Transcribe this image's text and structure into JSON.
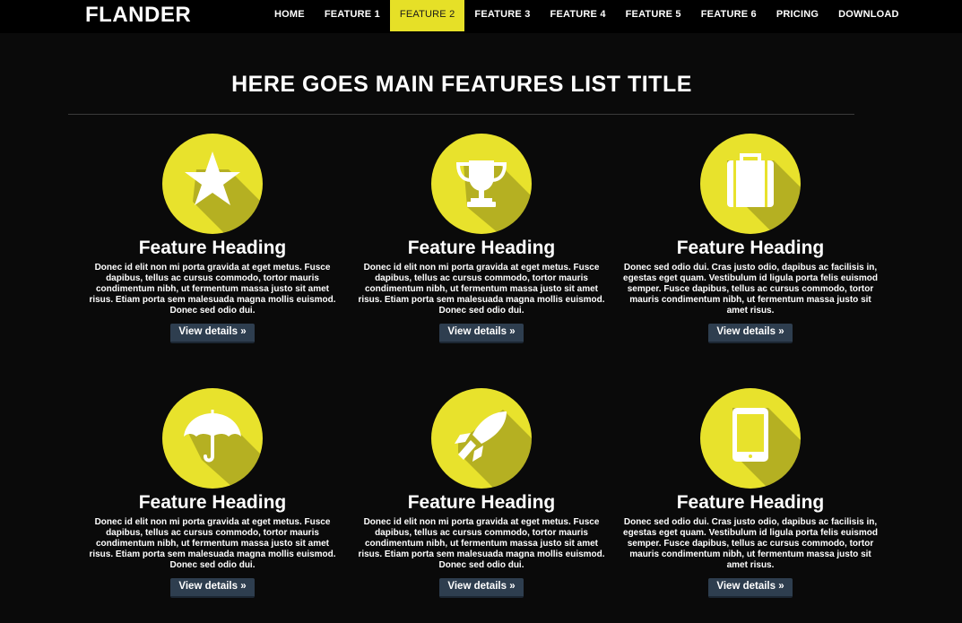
{
  "brand": "FLANDER",
  "nav": {
    "items": [
      {
        "label": "HOME",
        "active": false
      },
      {
        "label": "FEATURE 1",
        "active": false
      },
      {
        "label": "FEATURE 2",
        "active": true
      },
      {
        "label": "FEATURE 3",
        "active": false
      },
      {
        "label": "FEATURE 4",
        "active": false
      },
      {
        "label": "FEATURE 5",
        "active": false
      },
      {
        "label": "FEATURE 6",
        "active": false
      },
      {
        "label": "PRICING",
        "active": false
      },
      {
        "label": "DOWNLOAD",
        "active": false
      }
    ]
  },
  "colors": {
    "accent": "#e6e027",
    "background": "#0a0a0a",
    "button": "#2e3e4f"
  },
  "main": {
    "title": "HERE GOES MAIN FEATURES LIST TITLE"
  },
  "features": [
    {
      "icon": "star-icon",
      "heading": "Feature Heading",
      "text": "Donec id elit non mi porta gravida at eget metus. Fusce dapibus, tellus ac cursus commodo, tortor mauris condimentum nibh, ut fermentum massa justo sit amet risus. Etiam porta sem malesuada magna mollis euismod. Donec sed odio dui.",
      "button": "View details »"
    },
    {
      "icon": "trophy-icon",
      "heading": "Feature Heading",
      "text": "Donec id elit non mi porta gravida at eget metus. Fusce dapibus, tellus ac cursus commodo, tortor mauris condimentum nibh, ut fermentum massa justo sit amet risus. Etiam porta sem malesuada magna mollis euismod. Donec sed odio dui.",
      "button": "View details »"
    },
    {
      "icon": "briefcase-icon",
      "heading": "Feature Heading",
      "text": "Donec sed odio dui. Cras justo odio, dapibus ac facilisis in, egestas eget quam. Vestibulum id ligula porta felis euismod semper. Fusce dapibus, tellus ac cursus commodo, tortor mauris condimentum nibh, ut fermentum massa justo sit amet risus.",
      "button": "View details »"
    },
    {
      "icon": "umbrella-icon",
      "heading": "Feature Heading",
      "text": "Donec id elit non mi porta gravida at eget metus. Fusce dapibus, tellus ac cursus commodo, tortor mauris condimentum nibh, ut fermentum massa justo sit amet risus. Etiam porta sem malesuada magna mollis euismod. Donec sed odio dui.",
      "button": "View details »"
    },
    {
      "icon": "rocket-icon",
      "heading": "Feature Heading",
      "text": "Donec id elit non mi porta gravida at eget metus. Fusce dapibus, tellus ac cursus commodo, tortor mauris condimentum nibh, ut fermentum massa justo sit amet risus. Etiam porta sem malesuada magna mollis euismod. Donec sed odio dui.",
      "button": "View details »"
    },
    {
      "icon": "tablet-icon",
      "heading": "Feature Heading",
      "text": "Donec sed odio dui. Cras justo odio, dapibus ac facilisis in, egestas eget quam. Vestibulum id ligula porta felis euismod semper. Fusce dapibus, tellus ac cursus commodo, tortor mauris condimentum nibh, ut fermentum massa justo sit amet risus.",
      "button": "View details »"
    }
  ]
}
